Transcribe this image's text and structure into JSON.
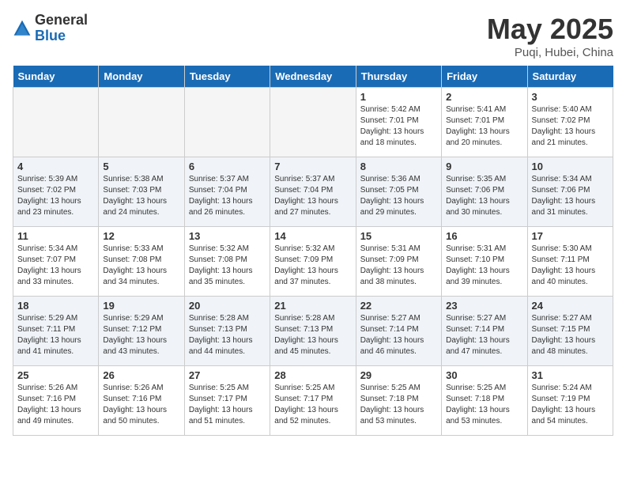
{
  "header": {
    "logo_general": "General",
    "logo_blue": "Blue",
    "month_year": "May 2025",
    "location": "Puqi, Hubei, China"
  },
  "days_of_week": [
    "Sunday",
    "Monday",
    "Tuesday",
    "Wednesday",
    "Thursday",
    "Friday",
    "Saturday"
  ],
  "weeks": [
    [
      {
        "day": "",
        "info": ""
      },
      {
        "day": "",
        "info": ""
      },
      {
        "day": "",
        "info": ""
      },
      {
        "day": "",
        "info": ""
      },
      {
        "day": "1",
        "info": "Sunrise: 5:42 AM\nSunset: 7:01 PM\nDaylight: 13 hours\nand 18 minutes."
      },
      {
        "day": "2",
        "info": "Sunrise: 5:41 AM\nSunset: 7:01 PM\nDaylight: 13 hours\nand 20 minutes."
      },
      {
        "day": "3",
        "info": "Sunrise: 5:40 AM\nSunset: 7:02 PM\nDaylight: 13 hours\nand 21 minutes."
      }
    ],
    [
      {
        "day": "4",
        "info": "Sunrise: 5:39 AM\nSunset: 7:02 PM\nDaylight: 13 hours\nand 23 minutes."
      },
      {
        "day": "5",
        "info": "Sunrise: 5:38 AM\nSunset: 7:03 PM\nDaylight: 13 hours\nand 24 minutes."
      },
      {
        "day": "6",
        "info": "Sunrise: 5:37 AM\nSunset: 7:04 PM\nDaylight: 13 hours\nand 26 minutes."
      },
      {
        "day": "7",
        "info": "Sunrise: 5:37 AM\nSunset: 7:04 PM\nDaylight: 13 hours\nand 27 minutes."
      },
      {
        "day": "8",
        "info": "Sunrise: 5:36 AM\nSunset: 7:05 PM\nDaylight: 13 hours\nand 29 minutes."
      },
      {
        "day": "9",
        "info": "Sunrise: 5:35 AM\nSunset: 7:06 PM\nDaylight: 13 hours\nand 30 minutes."
      },
      {
        "day": "10",
        "info": "Sunrise: 5:34 AM\nSunset: 7:06 PM\nDaylight: 13 hours\nand 31 minutes."
      }
    ],
    [
      {
        "day": "11",
        "info": "Sunrise: 5:34 AM\nSunset: 7:07 PM\nDaylight: 13 hours\nand 33 minutes."
      },
      {
        "day": "12",
        "info": "Sunrise: 5:33 AM\nSunset: 7:08 PM\nDaylight: 13 hours\nand 34 minutes."
      },
      {
        "day": "13",
        "info": "Sunrise: 5:32 AM\nSunset: 7:08 PM\nDaylight: 13 hours\nand 35 minutes."
      },
      {
        "day": "14",
        "info": "Sunrise: 5:32 AM\nSunset: 7:09 PM\nDaylight: 13 hours\nand 37 minutes."
      },
      {
        "day": "15",
        "info": "Sunrise: 5:31 AM\nSunset: 7:09 PM\nDaylight: 13 hours\nand 38 minutes."
      },
      {
        "day": "16",
        "info": "Sunrise: 5:31 AM\nSunset: 7:10 PM\nDaylight: 13 hours\nand 39 minutes."
      },
      {
        "day": "17",
        "info": "Sunrise: 5:30 AM\nSunset: 7:11 PM\nDaylight: 13 hours\nand 40 minutes."
      }
    ],
    [
      {
        "day": "18",
        "info": "Sunrise: 5:29 AM\nSunset: 7:11 PM\nDaylight: 13 hours\nand 41 minutes."
      },
      {
        "day": "19",
        "info": "Sunrise: 5:29 AM\nSunset: 7:12 PM\nDaylight: 13 hours\nand 43 minutes."
      },
      {
        "day": "20",
        "info": "Sunrise: 5:28 AM\nSunset: 7:13 PM\nDaylight: 13 hours\nand 44 minutes."
      },
      {
        "day": "21",
        "info": "Sunrise: 5:28 AM\nSunset: 7:13 PM\nDaylight: 13 hours\nand 45 minutes."
      },
      {
        "day": "22",
        "info": "Sunrise: 5:27 AM\nSunset: 7:14 PM\nDaylight: 13 hours\nand 46 minutes."
      },
      {
        "day": "23",
        "info": "Sunrise: 5:27 AM\nSunset: 7:14 PM\nDaylight: 13 hours\nand 47 minutes."
      },
      {
        "day": "24",
        "info": "Sunrise: 5:27 AM\nSunset: 7:15 PM\nDaylight: 13 hours\nand 48 minutes."
      }
    ],
    [
      {
        "day": "25",
        "info": "Sunrise: 5:26 AM\nSunset: 7:16 PM\nDaylight: 13 hours\nand 49 minutes."
      },
      {
        "day": "26",
        "info": "Sunrise: 5:26 AM\nSunset: 7:16 PM\nDaylight: 13 hours\nand 50 minutes."
      },
      {
        "day": "27",
        "info": "Sunrise: 5:25 AM\nSunset: 7:17 PM\nDaylight: 13 hours\nand 51 minutes."
      },
      {
        "day": "28",
        "info": "Sunrise: 5:25 AM\nSunset: 7:17 PM\nDaylight: 13 hours\nand 52 minutes."
      },
      {
        "day": "29",
        "info": "Sunrise: 5:25 AM\nSunset: 7:18 PM\nDaylight: 13 hours\nand 53 minutes."
      },
      {
        "day": "30",
        "info": "Sunrise: 5:25 AM\nSunset: 7:18 PM\nDaylight: 13 hours\nand 53 minutes."
      },
      {
        "day": "31",
        "info": "Sunrise: 5:24 AM\nSunset: 7:19 PM\nDaylight: 13 hours\nand 54 minutes."
      }
    ]
  ]
}
